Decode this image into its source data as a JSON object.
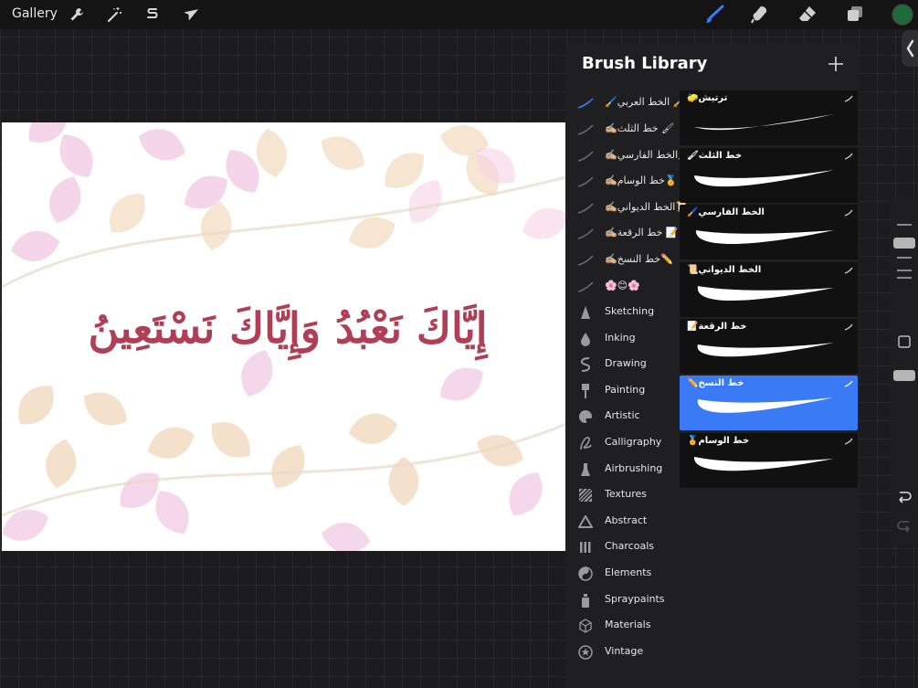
{
  "topbar": {
    "gallery_label": "Gallery",
    "left_tools": [
      "wrench-icon",
      "magic-wand-icon",
      "selection-s-icon",
      "move-arrow-icon"
    ],
    "right_tools": [
      "brush-icon",
      "smudge-icon",
      "eraser-icon",
      "layers-icon",
      "color-swatch"
    ],
    "active_tool_color": "#3a7bf5",
    "color_swatch": "#1f6b3a"
  },
  "canvas": {
    "text": "إِيَّاكَ نَعْبُدُ وَإِيَّاكَ نَسْتَعِينُ",
    "text_color": "#b03f56"
  },
  "brush_library": {
    "title": "Brush Library",
    "categories": [
      {
        "label": "🖌️الخط العربي 🖌️",
        "icon": "brush-stroke-icon",
        "active": true
      },
      {
        "label": "✍🏼خط الثلث 🖌",
        "icon": "brush-stroke-icon"
      },
      {
        "label": "✍🏼الخط الفارسي🖌️",
        "icon": "brush-stroke-icon"
      },
      {
        "label": "✍🏼خط الوسام🏅",
        "icon": "brush-stroke-icon"
      },
      {
        "label": "✍🏼الخط الديواني📜",
        "icon": "brush-stroke-icon"
      },
      {
        "label": "✍🏼خط الرقعة 📝",
        "icon": "brush-stroke-icon"
      },
      {
        "label": "✍🏼خط النسخ✏️",
        "icon": "brush-stroke-icon"
      },
      {
        "label": "🌸😊🌸",
        "icon": "brush-stroke-icon"
      },
      {
        "label": "Sketching",
        "icon": "pencil-tip-icon"
      },
      {
        "label": "Inking",
        "icon": "ink-drop-icon"
      },
      {
        "label": "Drawing",
        "icon": "squiggle-icon"
      },
      {
        "label": "Painting",
        "icon": "paint-brush-icon"
      },
      {
        "label": "Artistic",
        "icon": "palette-icon"
      },
      {
        "label": "Calligraphy",
        "icon": "calligraphy-a-icon"
      },
      {
        "label": "Airbrushing",
        "icon": "airbrush-icon"
      },
      {
        "label": "Textures",
        "icon": "texture-icon"
      },
      {
        "label": "Abstract",
        "icon": "triangle-icon"
      },
      {
        "label": "Charcoals",
        "icon": "charcoal-icon"
      },
      {
        "label": "Elements",
        "icon": "yin-yang-icon"
      },
      {
        "label": "Spraypaints",
        "icon": "spray-can-icon"
      },
      {
        "label": "Materials",
        "icon": "cube-icon"
      },
      {
        "label": "Vintage",
        "icon": "star-badge-icon"
      }
    ],
    "brushes": [
      {
        "name": "🧽ترتيش",
        "selected": false
      },
      {
        "name": "🖌خط الثلث",
        "selected": false
      },
      {
        "name": "🖌️الخط الفارسي",
        "selected": false
      },
      {
        "name": "📜الخط الديواني",
        "selected": false
      },
      {
        "name": "📝خط الرقعة",
        "selected": false
      },
      {
        "name": "✏️خط النسخ",
        "selected": true
      },
      {
        "name": "🏅خط الوسام",
        "selected": false
      }
    ]
  }
}
